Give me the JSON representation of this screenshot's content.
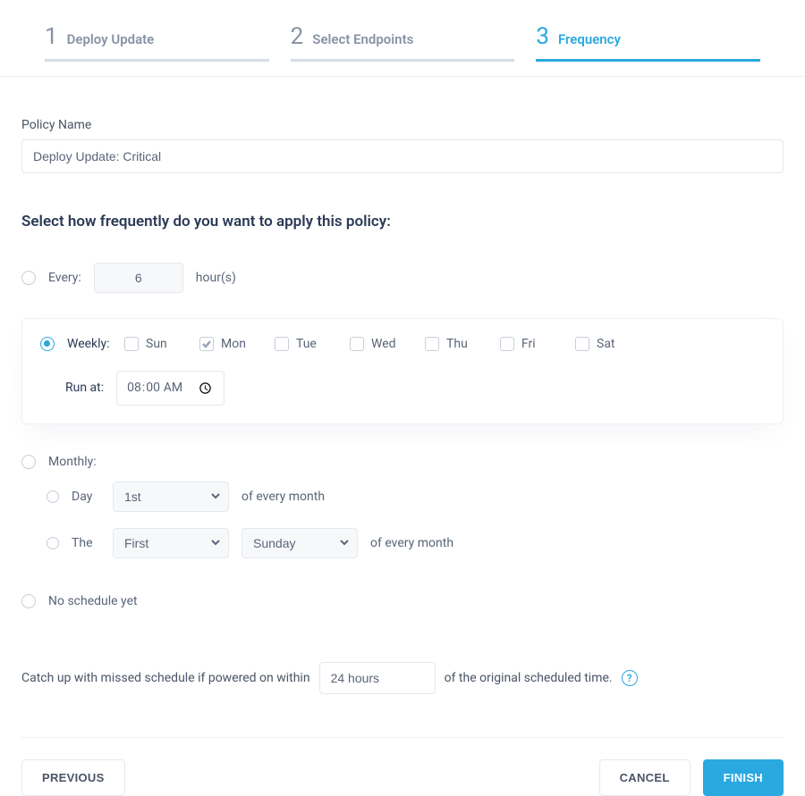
{
  "steps": [
    {
      "num": "1",
      "label": "Deploy Update"
    },
    {
      "num": "2",
      "label": "Select Endpoints"
    },
    {
      "num": "3",
      "label": "Frequency"
    }
  ],
  "policy_name_label": "Policy Name",
  "policy_name_value": "Deploy Update: Critical",
  "section_heading": "Select how frequently do you want to apply this policy:",
  "every": {
    "label": "Every:",
    "value": "6",
    "suffix": "hour(s)"
  },
  "weekly": {
    "label": "Weekly:",
    "days": [
      {
        "key": "sun",
        "label": "Sun",
        "checked": false
      },
      {
        "key": "mon",
        "label": "Mon",
        "checked": true
      },
      {
        "key": "tue",
        "label": "Tue",
        "checked": false
      },
      {
        "key": "wed",
        "label": "Wed",
        "checked": false
      },
      {
        "key": "thu",
        "label": "Thu",
        "checked": false
      },
      {
        "key": "fri",
        "label": "Fri",
        "checked": false
      },
      {
        "key": "sat",
        "label": "Sat",
        "checked": false
      }
    ],
    "run_at_label": "Run at:",
    "run_at_value": "08:00"
  },
  "monthly": {
    "label": "Monthly:",
    "day_label": "Day",
    "day_value": "1st",
    "day_suffix": "of every month",
    "the_label": "The",
    "ordinal_value": "First",
    "weekday_value": "Sunday",
    "the_suffix": "of every month"
  },
  "no_schedule_label": "No schedule yet",
  "catchup": {
    "pre": "Catch up with missed schedule if powered on within",
    "value": "24 hours",
    "post": "of the original scheduled time."
  },
  "buttons": {
    "previous": "PREVIOUS",
    "cancel": "CANCEL",
    "finish": "FINISH"
  }
}
